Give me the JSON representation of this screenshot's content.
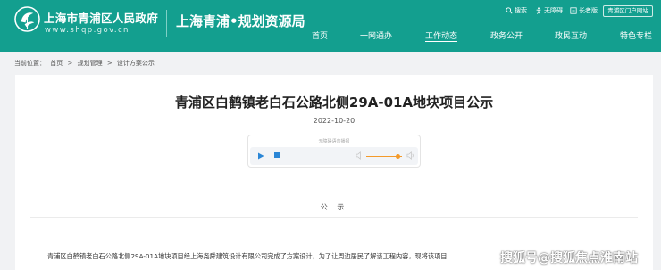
{
  "header": {
    "gov_title": "上海市青浦区人民政府",
    "gov_domain": "www.shqp.gov.cn",
    "bureau_title": "上海青浦•规划资源局",
    "bg_color": "#139f8f"
  },
  "top_links": {
    "search": "搜索",
    "accessibility": "无障碍",
    "elder": "长者版",
    "mobile": "青浦区门户网站"
  },
  "nav": {
    "items": [
      "首页",
      "一网通办",
      "工作动态",
      "政务公开",
      "政民互动",
      "特色专栏"
    ],
    "active": "工作动态"
  },
  "breadcrumb": {
    "prefix": "当前位置：",
    "items": [
      "首页",
      "规划管理",
      "设计方案公示"
    ],
    "separator": ">"
  },
  "article": {
    "title": "青浦区白鹤镇老白石公路北侧29A-01A地块项目公示",
    "date": "2022-10-20",
    "section_label": "公 示",
    "body": "青浦区白鹤镇老白石公路北侧29A-01A地块项目经上海尧舜建筑设计有限公司完成了方案设计，为了让周边居民了解该工程内容，现将该项目"
  },
  "player": {
    "hint": "无障碍语音播报",
    "accent_color": "#f49a2a",
    "control_color": "#2b86d6"
  },
  "watermark": "搜狐号@搜狐焦点淮南站"
}
